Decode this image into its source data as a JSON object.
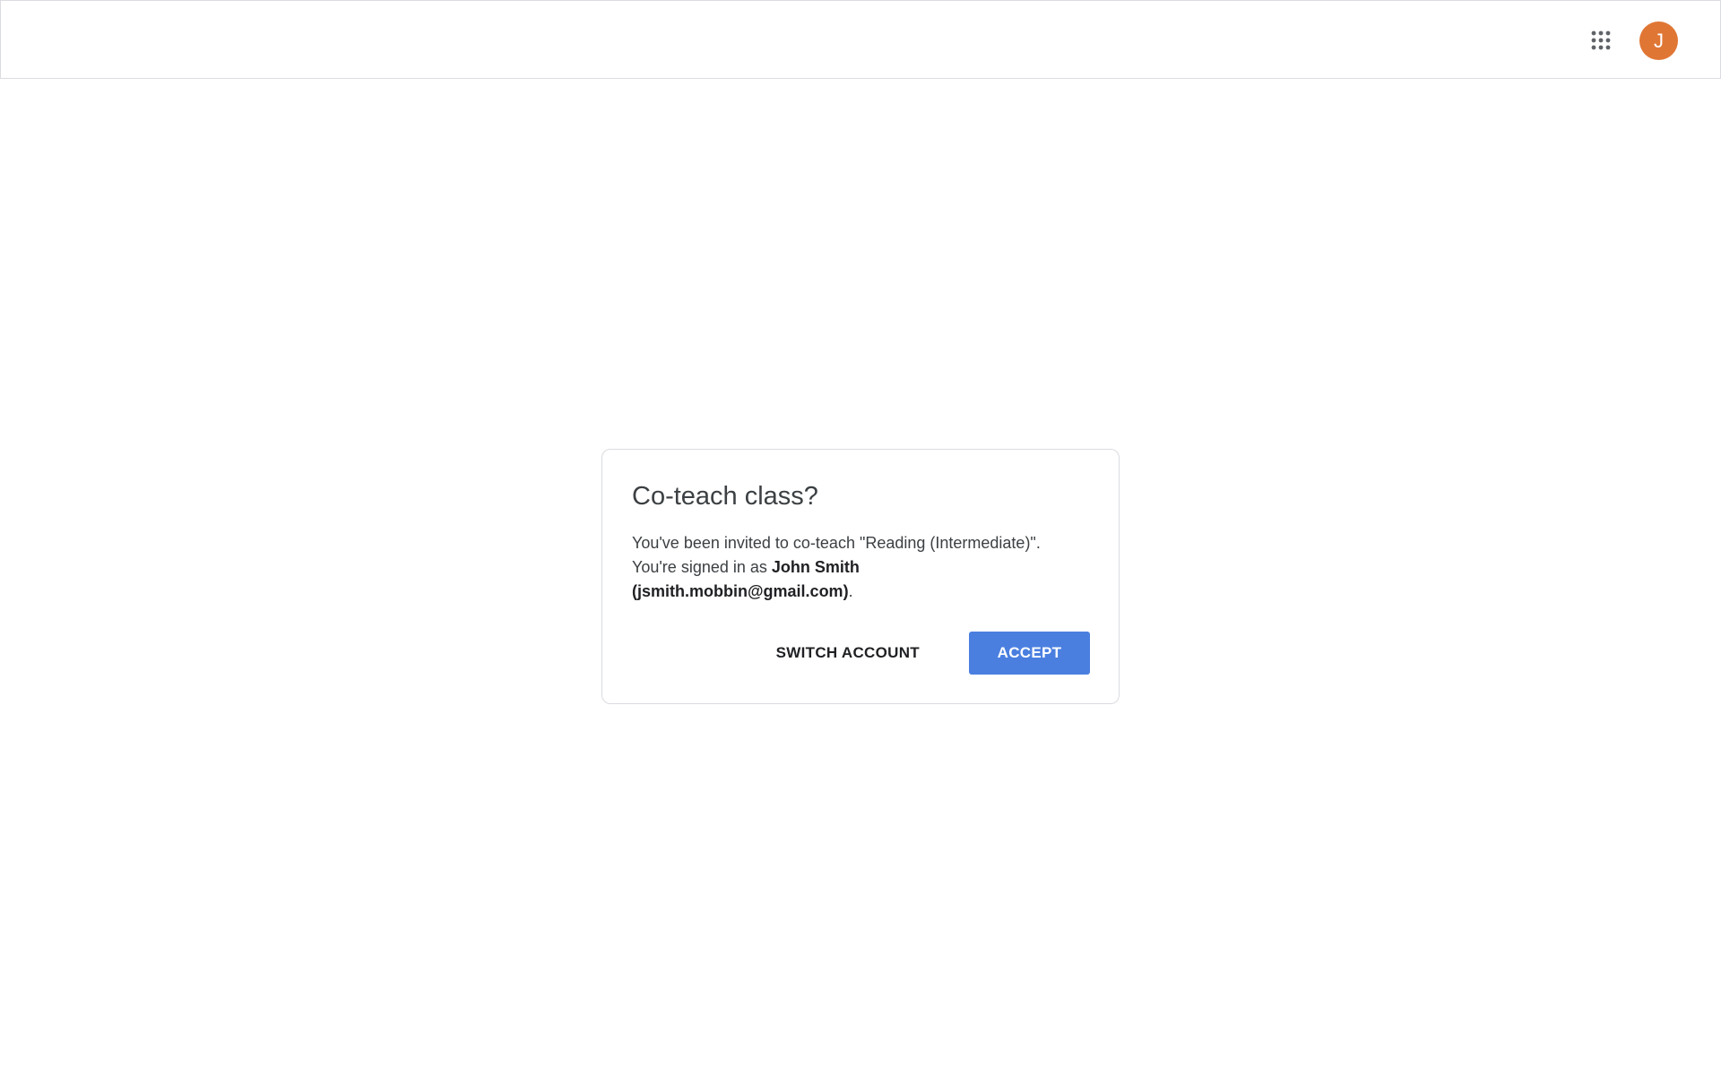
{
  "header": {
    "apps_icon": "apps-grid-icon",
    "avatar_initial": "J",
    "avatar_color": "#e07634"
  },
  "dialog": {
    "title": "Co-teach class?",
    "body_prefix": "You've been invited to co-teach \"Reading (Intermediate)\". You're signed in as ",
    "user_name": "John Smith",
    "user_email": "(jsmith.mobbin@gmail.com)",
    "body_suffix": ".",
    "switch_account_label": "SWITCH ACCOUNT",
    "accept_label": "ACCEPT",
    "accent_color": "#4a7fe0"
  }
}
